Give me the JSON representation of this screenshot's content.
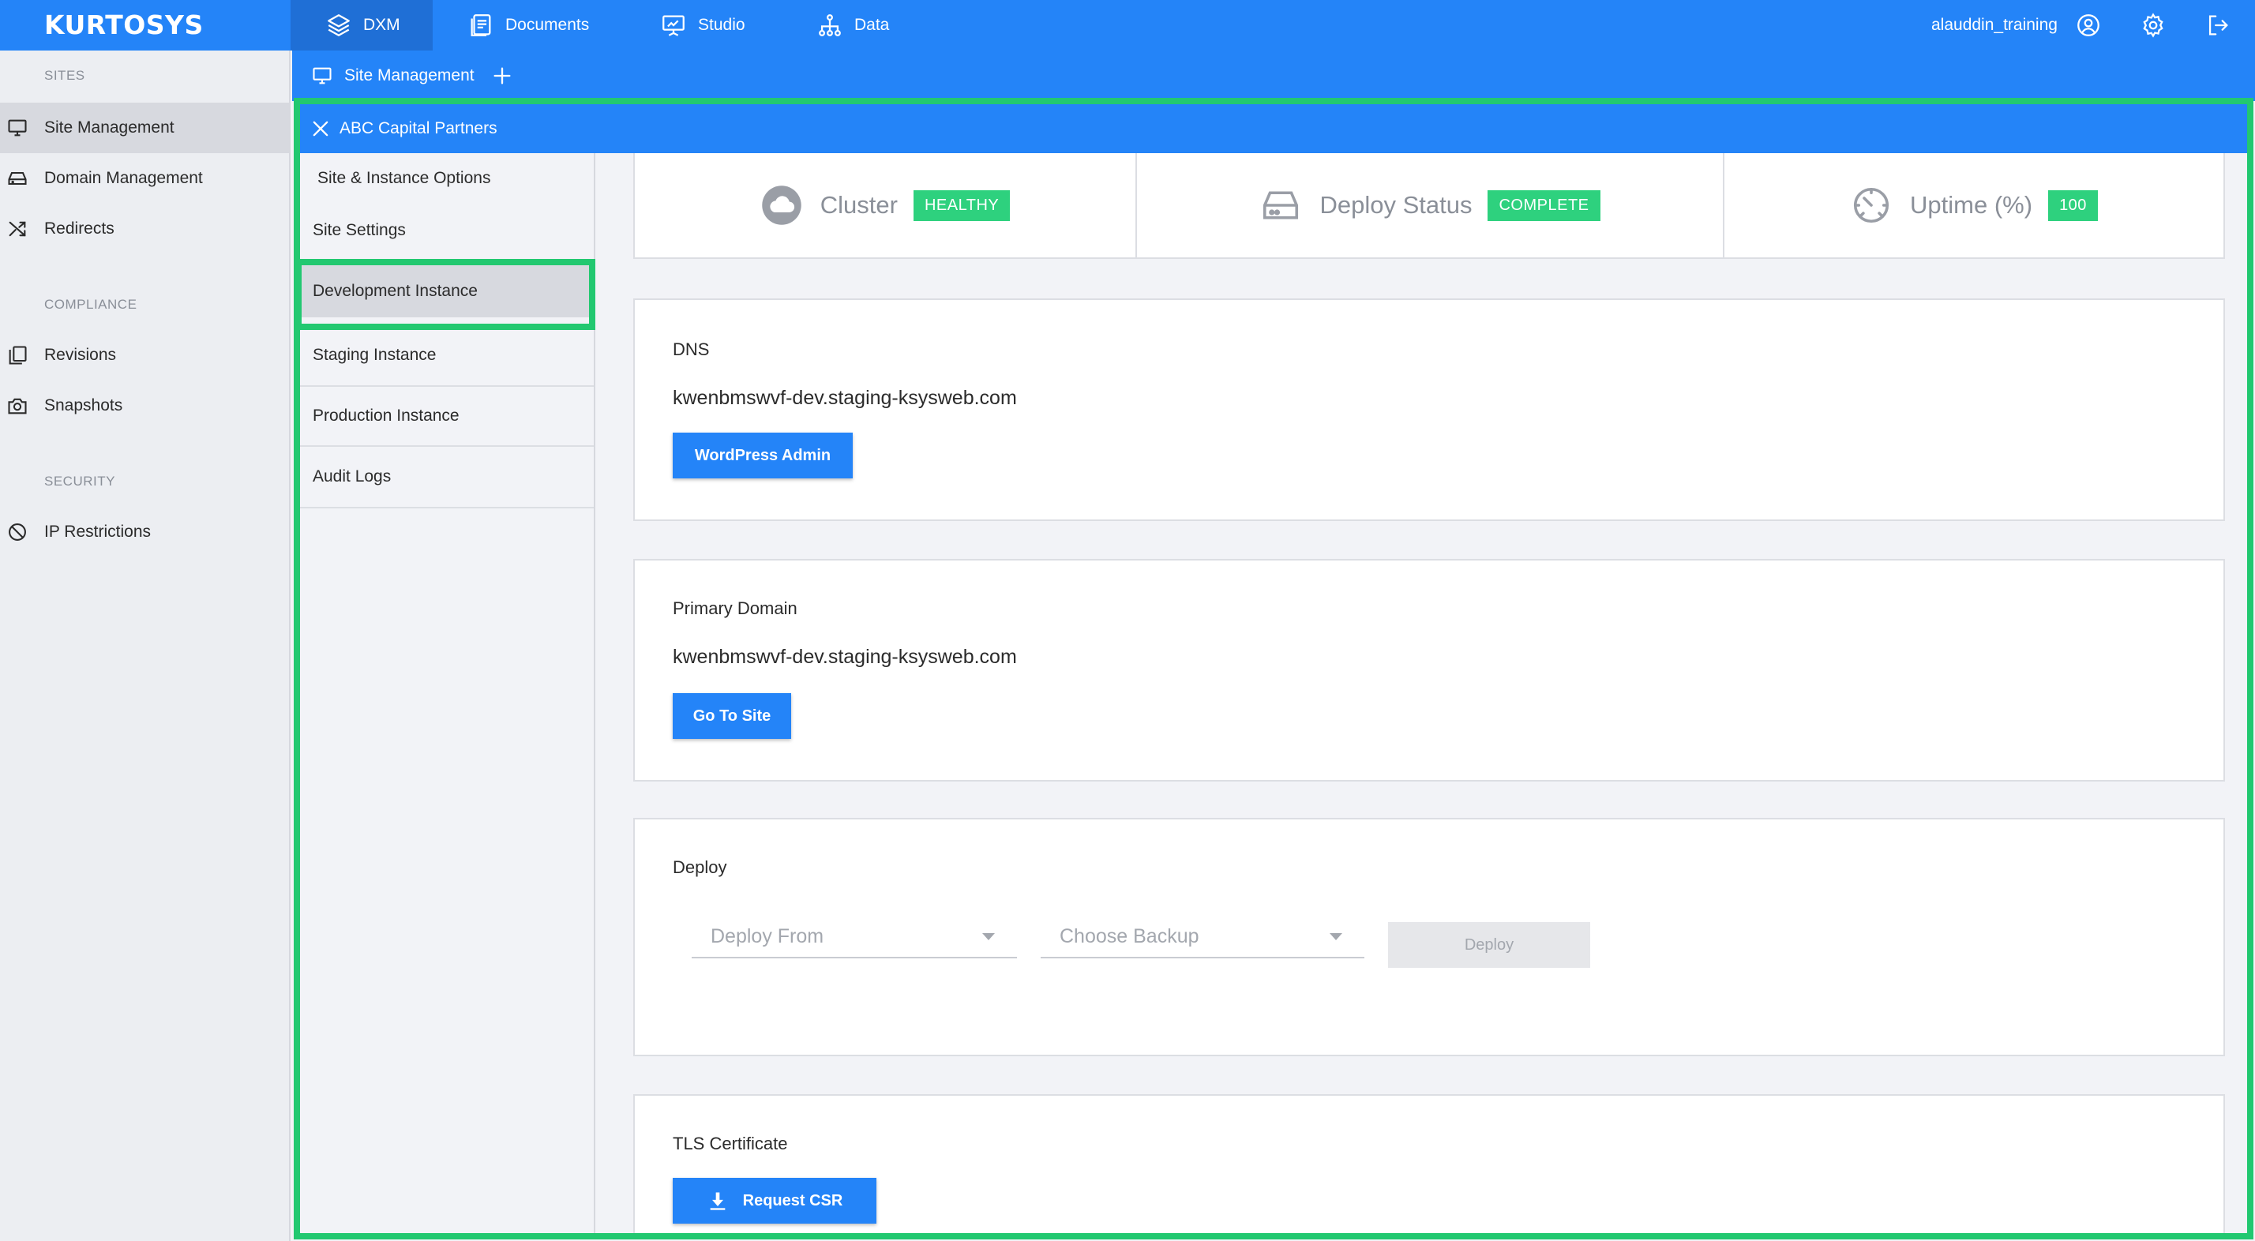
{
  "topbar": {
    "logo": "KURTOSYS",
    "nav": [
      {
        "label": "DXM",
        "icon": "layers-icon",
        "active": true
      },
      {
        "label": "Documents",
        "icon": "documents-icon"
      },
      {
        "label": "Studio",
        "icon": "presentation-icon"
      },
      {
        "label": "Data",
        "icon": "hierarchy-icon"
      }
    ],
    "username": "alauddin_training"
  },
  "sidebar": {
    "sections": [
      {
        "title": "SITES",
        "items": [
          {
            "label": "Site Management",
            "icon": "monitor-icon",
            "active": true
          },
          {
            "label": "Domain Management",
            "icon": "drive-icon"
          },
          {
            "label": "Redirects",
            "icon": "shuffle-icon"
          }
        ]
      },
      {
        "title": "COMPLIANCE",
        "items": [
          {
            "label": "Revisions",
            "icon": "copy-icon"
          },
          {
            "label": "Snapshots",
            "icon": "camera-icon"
          }
        ]
      },
      {
        "title": "SECURITY",
        "items": [
          {
            "label": "IP Restrictions",
            "icon": "block-icon"
          }
        ]
      }
    ]
  },
  "subbar": {
    "label": "Site Management"
  },
  "site": {
    "title": "ABC Capital Partners"
  },
  "inner_menu": [
    {
      "label": "Site & Instance Options"
    },
    {
      "label": "Site Settings"
    },
    {
      "label": "Development Instance",
      "active": true
    },
    {
      "label": "Staging Instance"
    },
    {
      "label": "Production Instance"
    },
    {
      "label": "Audit Logs"
    }
  ],
  "stats": [
    {
      "label": "Cluster",
      "badge": "HEALTHY",
      "icon": "cloud-icon"
    },
    {
      "label": "Deploy Status",
      "badge": "COMPLETE",
      "icon": "server-drive-icon"
    },
    {
      "label": "Uptime (%)",
      "badge": "100",
      "icon": "gauge-icon"
    }
  ],
  "dns": {
    "title": "DNS",
    "value": "kwenbmswvf-dev.staging-ksysweb.com",
    "button": "WordPress Admin"
  },
  "primary_domain": {
    "title": "Primary Domain",
    "value": "kwenbmswvf-dev.staging-ksysweb.com",
    "button": "Go To Site"
  },
  "deploy": {
    "title": "Deploy",
    "from_placeholder": "Deploy From",
    "backup_placeholder": "Choose Backup",
    "button": "Deploy"
  },
  "tls": {
    "title": "TLS Certificate",
    "button": "Request CSR"
  },
  "colors": {
    "primary": "#2484f8",
    "highlight": "#22c870",
    "badge": "#2ed17e"
  }
}
